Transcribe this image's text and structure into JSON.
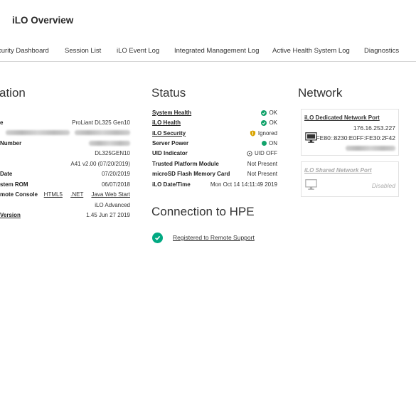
{
  "header": {
    "title": "iLO Overview"
  },
  "tabs": [
    {
      "label": "curity Dashboard"
    },
    {
      "label": "Session List"
    },
    {
      "label": "iLO Event Log"
    },
    {
      "label": "Integrated Management Log"
    },
    {
      "label": "Active Health System Log"
    },
    {
      "label": "Diagnostics"
    }
  ],
  "information": {
    "title": "ation",
    "rows": [
      {
        "label": "e",
        "value": "ProLiant DL325 Gen10"
      },
      {
        "label": "",
        "value": ""
      },
      {
        "label": "Number",
        "value": ""
      },
      {
        "label": "",
        "value": "DL325GEN10"
      },
      {
        "label": "",
        "value": "A41 v2.00 (07/20/2019)"
      },
      {
        "label": "Date",
        "value": "07/20/2019"
      },
      {
        "label": "stem ROM",
        "value": "06/07/2018"
      },
      {
        "label": "mote Console",
        "value": ""
      },
      {
        "label": "",
        "value": "iLO Advanced"
      },
      {
        "label": "Version",
        "value": "1.45 Jun 27 2019"
      }
    ],
    "console_links": [
      "HTML5",
      ".NET",
      "Java Web Start"
    ]
  },
  "status": {
    "title": "Status",
    "rows": [
      {
        "label": "System Health",
        "value": "OK",
        "icon": "ok-icon"
      },
      {
        "label": "iLO Health",
        "value": "OK",
        "icon": "ok-icon"
      },
      {
        "label": "iLO Security",
        "value": "Ignored",
        "icon": "shield-warning-icon"
      },
      {
        "label": "Server Power",
        "value": "ON",
        "icon": "power-on-icon"
      },
      {
        "label": "UID Indicator",
        "value": "UID OFF",
        "icon": "uid-icon"
      },
      {
        "label": "Trusted Platform Module",
        "value": "Not Present",
        "icon": ""
      },
      {
        "label": "microSD Flash Memory Card",
        "value": "Not Present",
        "icon": ""
      },
      {
        "label": "iLO Date/Time",
        "value": "Mon Oct 14 14:11:49 2019",
        "icon": ""
      }
    ]
  },
  "connection": {
    "title": "Connection to HPE",
    "link": "Registered to Remote Support"
  },
  "network": {
    "title": "Network",
    "dedicated": {
      "title": "iLO Dedicated Network Port",
      "ipv4": "176.16.253.227",
      "ipv6": "FE80::8230:E0FF:FE30:2F42"
    },
    "shared": {
      "title": "iLO Shared Network Port",
      "state": "Disabled"
    }
  },
  "colors": {
    "ok": "#12a36b",
    "warning": "#d9a400",
    "connected": "#01a982",
    "disabled_text": "#aaaaaa"
  }
}
